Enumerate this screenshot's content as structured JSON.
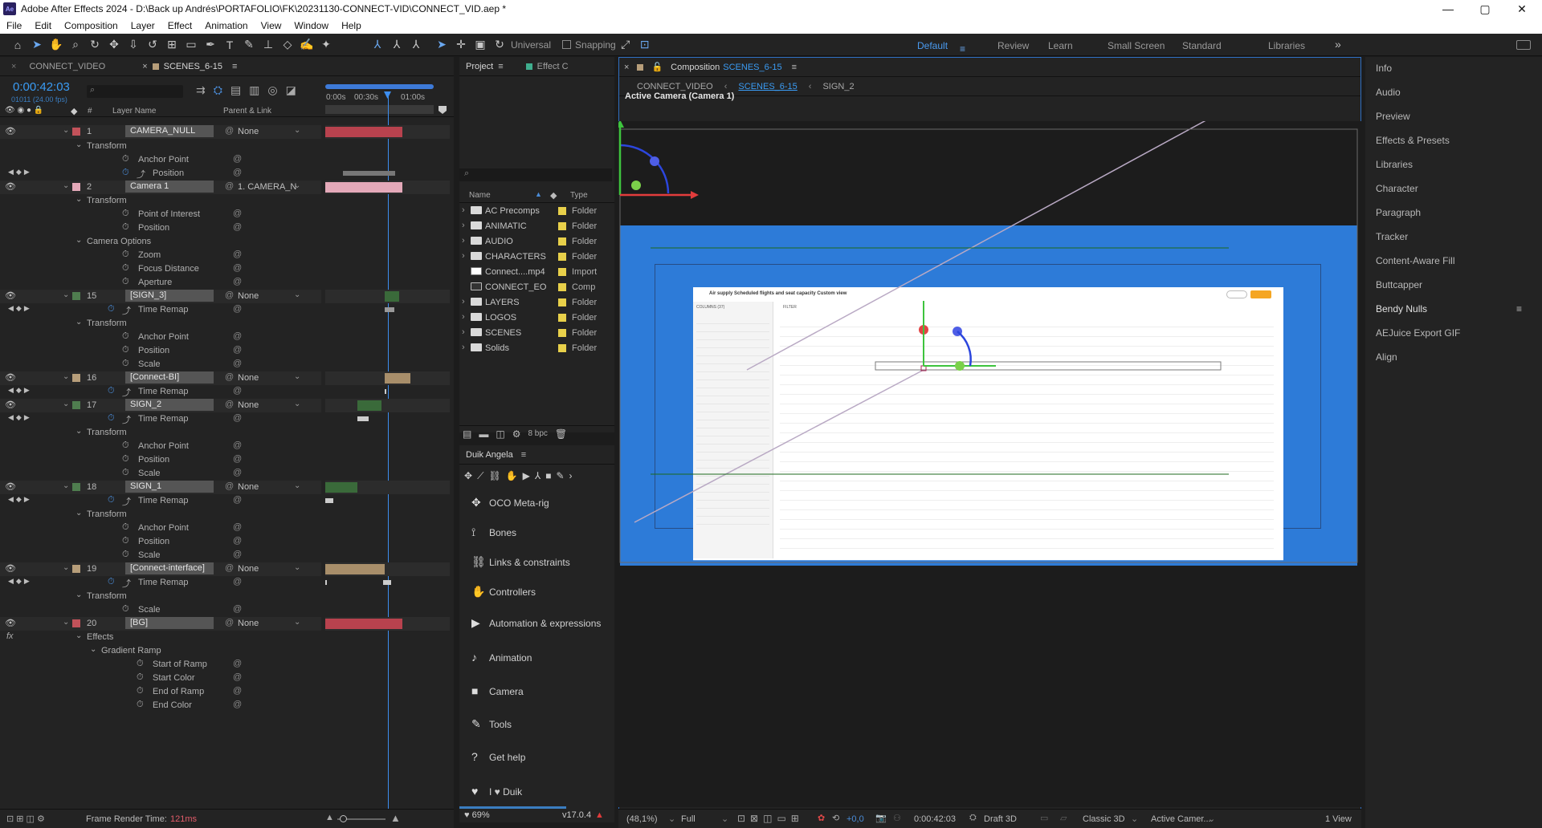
{
  "titlebar": {
    "logo": "Ae",
    "title": "Adobe After Effects 2024 - D:\\Back up Andrés\\PORTAFOLIO\\FK\\20231130-CONNECT-VID\\CONNECT_VID.aep *",
    "min": "—",
    "max": "▢",
    "close": "✕"
  },
  "menu": [
    "File",
    "Edit",
    "Composition",
    "Layer",
    "Effect",
    "Animation",
    "View",
    "Window",
    "Help"
  ],
  "toolbar": {
    "universal": "Universal",
    "snapping": "Snapping"
  },
  "workspaces": [
    "Default",
    "Review",
    "Learn",
    "Small Screen",
    "Standard",
    "Libraries"
  ],
  "timeline": {
    "tabs": [
      "CONNECT_VIDEO",
      "SCENES_6-15"
    ],
    "timecode": "0:00:42:03",
    "frames": "01011 (24.00 fps)",
    "col_layer": "Layer Name",
    "col_parent": "Parent & Link",
    "col_num": "#",
    "ruler": [
      "0:00s",
      "00:30s",
      "01:00s"
    ],
    "rows": [
      {
        "type": "layer",
        "num": "1",
        "name": "CAMERA_NULL",
        "parent": "None",
        "color": "#c2525a"
      },
      {
        "type": "prop",
        "label": "Transform",
        "indent": 1
      },
      {
        "type": "prop",
        "label": "Anchor Point",
        "indent": 3
      },
      {
        "type": "prop",
        "label": "Position",
        "indent": 3,
        "kf": true
      },
      {
        "type": "layer",
        "num": "2",
        "name": "Camera 1",
        "parent": "1. CAMERA_N",
        "color": "#e4a9b9"
      },
      {
        "type": "prop",
        "label": "Transform",
        "indent": 1
      },
      {
        "type": "prop",
        "label": "Point of Interest",
        "indent": 3
      },
      {
        "type": "prop",
        "label": "Position",
        "indent": 3
      },
      {
        "type": "prop",
        "label": "Camera Options",
        "indent": 1
      },
      {
        "type": "prop",
        "label": "Zoom",
        "indent": 3
      },
      {
        "type": "prop",
        "label": "Focus Distance",
        "indent": 3
      },
      {
        "type": "prop",
        "label": "Aperture",
        "indent": 3
      },
      {
        "type": "layer",
        "num": "15",
        "name": "[SIGN_3]",
        "parent": "None",
        "color": "#4f7d4f"
      },
      {
        "type": "prop",
        "label": "Time Remap",
        "indent": 2,
        "kf": true
      },
      {
        "type": "prop",
        "label": "Transform",
        "indent": 1
      },
      {
        "type": "prop",
        "label": "Anchor Point",
        "indent": 3
      },
      {
        "type": "prop",
        "label": "Position",
        "indent": 3
      },
      {
        "type": "prop",
        "label": "Scale",
        "indent": 3
      },
      {
        "type": "layer",
        "num": "16",
        "name": "[Connect-BI]",
        "parent": "None",
        "color": "#b79e7a"
      },
      {
        "type": "prop",
        "label": "Time Remap",
        "indent": 2,
        "kf": true
      },
      {
        "type": "layer",
        "num": "17",
        "name": "SIGN_2",
        "parent": "None",
        "color": "#4f7d4f"
      },
      {
        "type": "prop",
        "label": "Time Remap",
        "indent": 2,
        "kf": true
      },
      {
        "type": "prop",
        "label": "Transform",
        "indent": 1
      },
      {
        "type": "prop",
        "label": "Anchor Point",
        "indent": 3
      },
      {
        "type": "prop",
        "label": "Position",
        "indent": 3
      },
      {
        "type": "prop",
        "label": "Scale",
        "indent": 3
      },
      {
        "type": "layer",
        "num": "18",
        "name": "SIGN_1",
        "parent": "None",
        "color": "#4f7d4f"
      },
      {
        "type": "prop",
        "label": "Time Remap",
        "indent": 2,
        "kf": true
      },
      {
        "type": "prop",
        "label": "Transform",
        "indent": 1
      },
      {
        "type": "prop",
        "label": "Anchor Point",
        "indent": 3
      },
      {
        "type": "prop",
        "label": "Position",
        "indent": 3
      },
      {
        "type": "prop",
        "label": "Scale",
        "indent": 3
      },
      {
        "type": "layer",
        "num": "19",
        "name": "[Connect-interface]",
        "parent": "None",
        "color": "#b79e7a"
      },
      {
        "type": "prop",
        "label": "Time Remap",
        "indent": 2,
        "kf": true
      },
      {
        "type": "prop",
        "label": "Transform",
        "indent": 1
      },
      {
        "type": "prop",
        "label": "Scale",
        "indent": 3
      },
      {
        "type": "layer",
        "num": "20",
        "name": "[BG]",
        "parent": "None",
        "color": "#c2525a"
      },
      {
        "type": "prop",
        "label": "Effects",
        "indent": 1
      },
      {
        "type": "prop",
        "label": "Gradient Ramp",
        "indent": 2
      },
      {
        "type": "prop",
        "label": "Start of Ramp",
        "indent": 4
      },
      {
        "type": "prop",
        "label": "Start Color",
        "indent": 4
      },
      {
        "type": "prop",
        "label": "End of Ramp",
        "indent": 4
      },
      {
        "type": "prop",
        "label": "End Color",
        "indent": 4
      }
    ],
    "frame_render_label": "Frame Render Time:",
    "frame_render_value": "121ms"
  },
  "project": {
    "tabs": [
      "Project",
      "Effect C"
    ],
    "col_name": "Name",
    "col_type": "Type",
    "items": [
      {
        "name": "AC Precomps",
        "type": "Folder",
        "icon": "folder-icon"
      },
      {
        "name": "ANIMATIC",
        "type": "Folder",
        "icon": "folder-icon"
      },
      {
        "name": "AUDIO",
        "type": "Folder",
        "icon": "folder-icon"
      },
      {
        "name": "CHARACTERS",
        "type": "Folder",
        "icon": "folder-icon"
      },
      {
        "name": "Connect....mp4",
        "type": "Import",
        "icon": "footage-icon"
      },
      {
        "name": "CONNECT_EO",
        "type": "Comp",
        "icon": "comp-icon"
      },
      {
        "name": "LAYERS",
        "type": "Folder",
        "icon": "folder-icon"
      },
      {
        "name": "LOGOS",
        "type": "Folder",
        "icon": "folder-icon"
      },
      {
        "name": "SCENES",
        "type": "Folder",
        "icon": "folder-icon"
      },
      {
        "name": "Solids",
        "type": "Folder",
        "icon": "folder-icon"
      }
    ],
    "bpc": "8 bpc"
  },
  "duik": {
    "title": "Duik Angela",
    "items": [
      {
        "label": "OCO Meta-rig",
        "icon": "metarig-icon",
        "glyph": "✥"
      },
      {
        "label": "Bones",
        "icon": "bones-icon",
        "glyph": "⟟"
      },
      {
        "label": "Links & constraints",
        "icon": "link-icon",
        "glyph": "⛓"
      },
      {
        "label": "Controllers",
        "icon": "hand-icon",
        "glyph": "✋"
      },
      {
        "label": "Automation & expressions",
        "icon": "play-icon",
        "glyph": "▶"
      },
      {
        "label": "Animation",
        "icon": "animation-icon",
        "glyph": "♪"
      },
      {
        "label": "Camera",
        "icon": "camera-icon",
        "glyph": "■"
      },
      {
        "label": "Tools",
        "icon": "tools-icon",
        "glyph": "✎"
      },
      {
        "label": "Get help",
        "icon": "help-icon",
        "glyph": "?"
      },
      {
        "label": "I ♥ Duik",
        "icon": "heart-icon",
        "glyph": "♥"
      }
    ],
    "progress_label": "69%",
    "version": "v17.0.4"
  },
  "composition": {
    "panel_label": "Composition",
    "comp_name": "SCENES_6-15",
    "breadcrumbs": [
      "CONNECT_VIDEO",
      "SCENES_6-15",
      "SIGN_2"
    ],
    "view_label": "Active Camera (Camera 1)",
    "status": {
      "zoom": "(48,1%)",
      "resolution": "Full",
      "exposure": "+0,0",
      "timecode": "0:00:42:03",
      "draft": "Draft 3D",
      "renderer": "Classic 3D",
      "camera": "Active Camer...",
      "views": "1 View"
    }
  },
  "right_panel": [
    "Info",
    "Audio",
    "Preview",
    "Effects & Presets",
    "Libraries",
    "Character",
    "Paragraph",
    "Tracker",
    "Content-Aware Fill",
    "Buttcapper",
    "Bendy Nulls",
    "AEJuice Export GIF",
    "Align"
  ],
  "inner_ui": {
    "title": "Air supply Scheduled flights and seat capacity Custom view",
    "columns_label": "COLUMNS (37)",
    "filter_label": "FILTER"
  }
}
